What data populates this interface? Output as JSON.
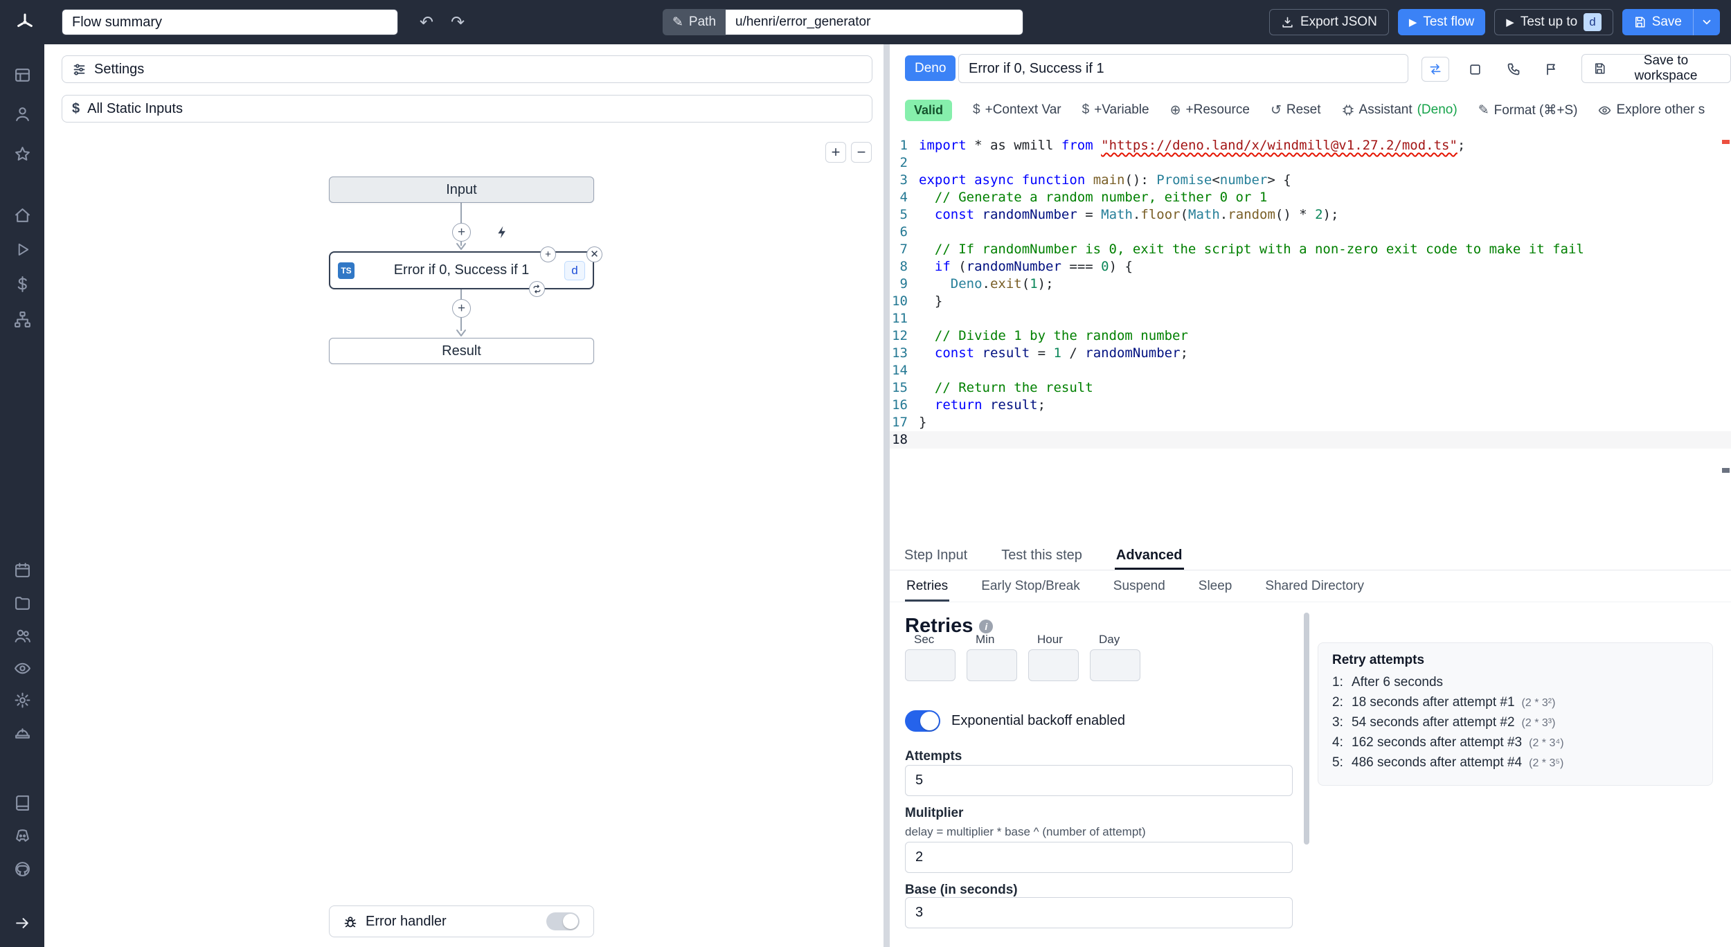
{
  "colors": {
    "topbar_bg": "#252c3a",
    "accent_blue": "#3b82f6",
    "toggle_on_blue": "#2563eb",
    "valid_green_bg": "#86efac",
    "ts_badge_blue": "#3178c6",
    "assistant_green": "#16a34a"
  },
  "topbar": {
    "flow_summary": "Flow summary",
    "path_label": "Path",
    "path_value": "u/henri/error_generator",
    "export_json": "Export JSON",
    "test_flow": "Test flow",
    "test_up_to": "Test up to",
    "test_up_to_badge": "d",
    "save": "Save"
  },
  "sidebar": {
    "icons": [
      "table-icon",
      "user-icon",
      "star-icon",
      "home-icon",
      "play-icon",
      "dollar-icon",
      "sitemap-icon",
      "calendar-icon",
      "folder-icon",
      "users-icon",
      "eye-icon",
      "gear-icon",
      "worker-icon",
      "book-icon",
      "discord-icon",
      "github-icon",
      "arrow-right-icon"
    ]
  },
  "flow_panel": {
    "settings": "Settings",
    "all_static_inputs": "All Static Inputs",
    "zoom_in": "+",
    "zoom_out": "−",
    "nodes": {
      "input": "Input",
      "step_label": "Error if 0, Success if 1",
      "step_lang_badge": "TS",
      "step_id_badge": "d",
      "result": "Result"
    },
    "error_handler": "Error handler"
  },
  "editor": {
    "lang_badge": "Deno",
    "summary_value": "Error if 0, Success if 1",
    "save_to_workspace": "Save to workspace",
    "toolbar": {
      "valid": "Valid",
      "context_var": "+Context Var",
      "variable": "+Variable",
      "resource": "+Resource",
      "reset": "Reset",
      "assistant": "Assistant",
      "assistant_lang": "(Deno)",
      "format": "Format (⌘+S)",
      "explore": "Explore other s"
    },
    "active_line": 18,
    "code_lines": [
      [
        [
          "kw",
          "import"
        ],
        [
          "pl",
          " * as wmill "
        ],
        [
          "kw",
          "from"
        ],
        [
          "pl",
          " "
        ],
        [
          "stru",
          "\"https://deno.land/x/windmill@v1.27.2/mod.ts\""
        ],
        [
          "pl",
          ";"
        ]
      ],
      [],
      [
        [
          "kw",
          "export"
        ],
        [
          "pl",
          " "
        ],
        [
          "kw",
          "async"
        ],
        [
          "pl",
          " "
        ],
        [
          "kw",
          "function"
        ],
        [
          "pl",
          " "
        ],
        [
          "fn",
          "main"
        ],
        [
          "pl",
          "(): "
        ],
        [
          "type",
          "Promise"
        ],
        [
          "pl",
          "<"
        ],
        [
          "type",
          "number"
        ],
        [
          "pl",
          "> {"
        ]
      ],
      [
        [
          "cm",
          "  // Generate a random number, either 0 or 1"
        ]
      ],
      [
        [
          "pl",
          "  "
        ],
        [
          "kw",
          "const"
        ],
        [
          "pl",
          " "
        ],
        [
          "var",
          "randomNumber"
        ],
        [
          "pl",
          " = "
        ],
        [
          "type",
          "Math"
        ],
        [
          "pl",
          "."
        ],
        [
          "fn",
          "floor"
        ],
        [
          "pl",
          "("
        ],
        [
          "type",
          "Math"
        ],
        [
          "pl",
          "."
        ],
        [
          "fn",
          "random"
        ],
        [
          "pl",
          "() * "
        ],
        [
          "num",
          "2"
        ],
        [
          "pl",
          ");"
        ]
      ],
      [],
      [
        [
          "cm",
          "  // If randomNumber is 0, exit the script with a non-zero exit code to make it fail"
        ]
      ],
      [
        [
          "pl",
          "  "
        ],
        [
          "kw",
          "if"
        ],
        [
          "pl",
          " ("
        ],
        [
          "var",
          "randomNumber"
        ],
        [
          "pl",
          " === "
        ],
        [
          "num",
          "0"
        ],
        [
          "pl",
          ") {"
        ]
      ],
      [
        [
          "pl",
          "    "
        ],
        [
          "type",
          "Deno"
        ],
        [
          "pl",
          "."
        ],
        [
          "fn",
          "exit"
        ],
        [
          "pl",
          "("
        ],
        [
          "num",
          "1"
        ],
        [
          "pl",
          ");"
        ]
      ],
      [
        [
          "pl",
          "  }"
        ]
      ],
      [],
      [
        [
          "cm",
          "  // Divide 1 by the random number"
        ]
      ],
      [
        [
          "pl",
          "  "
        ],
        [
          "kw",
          "const"
        ],
        [
          "pl",
          " "
        ],
        [
          "var",
          "result"
        ],
        [
          "pl",
          " = "
        ],
        [
          "num",
          "1"
        ],
        [
          "pl",
          " / "
        ],
        [
          "var",
          "randomNumber"
        ],
        [
          "pl",
          ";"
        ]
      ],
      [],
      [
        [
          "cm",
          "  // Return the result"
        ]
      ],
      [
        [
          "pl",
          "  "
        ],
        [
          "kw",
          "return"
        ],
        [
          "pl",
          " "
        ],
        [
          "var",
          "result"
        ],
        [
          "pl",
          ";"
        ]
      ],
      [
        [
          "pl",
          "}"
        ]
      ],
      []
    ]
  },
  "step_panel": {
    "tabs": [
      "Step Input",
      "Test this step",
      "Advanced"
    ],
    "subtabs": [
      "Retries",
      "Early Stop/Break",
      "Suspend",
      "Sleep",
      "Shared Directory"
    ],
    "retries": {
      "title": "Retries",
      "cron_labels": [
        "Sec",
        "Min",
        "Hour",
        "Day"
      ],
      "toggle_label": "Exponential backoff enabled",
      "attempts_label": "Attempts",
      "attempts_value": "5",
      "multiplier_label": "Mulitplier",
      "multiplier_desc": "delay = multiplier * base ^ (number of attempt)",
      "multiplier_value": "2",
      "base_label": "Base (in seconds)",
      "base_value": "3",
      "retry_attempts": {
        "title": "Retry attempts",
        "items": [
          {
            "n": "1:",
            "text": "After 6 seconds",
            "formula": ""
          },
          {
            "n": "2:",
            "text": "18 seconds after attempt #1",
            "formula": "(2 * 3²)"
          },
          {
            "n": "3:",
            "text": "54 seconds after attempt #2",
            "formula": "(2 * 3³)"
          },
          {
            "n": "4:",
            "text": "162 seconds after attempt #3",
            "formula": "(2 * 3⁴)"
          },
          {
            "n": "5:",
            "text": "486 seconds after attempt #4",
            "formula": "(2 * 3⁵)"
          }
        ]
      }
    }
  }
}
